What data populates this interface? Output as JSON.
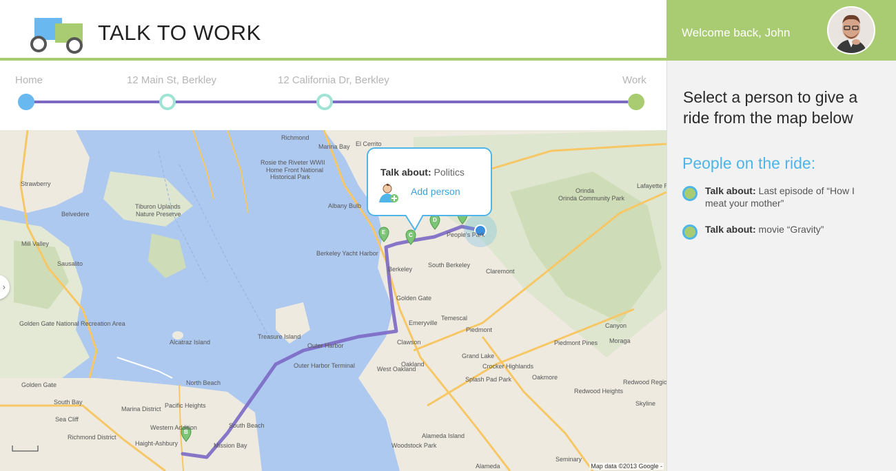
{
  "header": {
    "title": "TALK TO WORK"
  },
  "user": {
    "welcome": "Welcome back, John"
  },
  "route": {
    "stops": [
      {
        "label": "Home",
        "color": "#6ab8f0",
        "kind": "start"
      },
      {
        "label": "12 Main St, Berkley",
        "color": "#9fe3d5",
        "kind": "waypoint"
      },
      {
        "label": "12 California Dr, Berkley",
        "color": "#9fe3d5",
        "kind": "waypoint"
      },
      {
        "label": "Work",
        "color": "#a9cc72",
        "kind": "end"
      }
    ],
    "line_color": "#7b69c4"
  },
  "sidebar": {
    "instructions": "Select a person to give a ride from the map below",
    "people_heading": "People on the ride:",
    "people": [
      {
        "label": "Talk about:",
        "topic": "Last episode of “How I meat your mother”"
      },
      {
        "label": "Talk about:",
        "topic": "movie “Gravity”"
      }
    ]
  },
  "popup": {
    "topic_label": "Talk about:",
    "topic_value": "Politics",
    "action": "Add person"
  },
  "map": {
    "credit": "Map data ©2013 Google -",
    "labels": [
      "El Cerrito",
      "Richmond",
      "Marina Bay",
      "Rosie the Riveter WWII",
      "Home Front National",
      "Historical Park",
      "Albany Bulb",
      "Orinda",
      "Orinda Community Park",
      "Lafayette Reservoir Recreation Area",
      "Strawberry",
      "Tiburon Uplands",
      "Nature Preserve",
      "Belvedere",
      "Mill Valley",
      "Sausalito",
      "Berkeley",
      "Berkeley Yacht Harbor",
      "South Berkeley",
      "People's Park",
      "Claremont",
      "Golden Gate",
      "Emeryville",
      "Temescal",
      "Piedmont",
      "Canyon",
      "Golden Gate National Recreation Area",
      "Alcatraz Island",
      "Treasure Island",
      "Outer Harbor",
      "Outer Harbor Terminal",
      "Clawson",
      "West Oakland",
      "Oakland",
      "Grand Lake",
      "Piedmont Pines",
      "Moraga",
      "Golden Gate",
      "North Beach",
      "Pacific Heights",
      "Marina District",
      "South Bay",
      "Sea Cliff",
      "Richmond District",
      "Western Addition",
      "Haight-Ashbury",
      "Mission Bay",
      "South Beach",
      "Splash Pad Park",
      "Crocker Highlands",
      "Redwood Heights",
      "Skyline",
      "Alameda Island",
      "Woodstock Park",
      "Alameda",
      "Seminary",
      "Oakmore",
      "Redwood Regional Park"
    ]
  }
}
